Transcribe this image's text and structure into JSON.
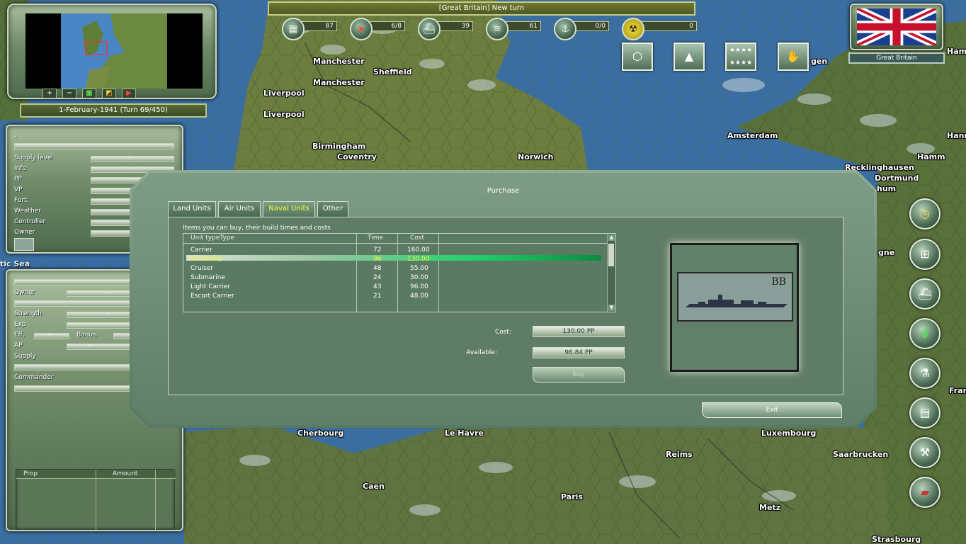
{
  "map": {
    "cities": [
      "Manchester",
      "Manchester",
      "Sheffield",
      "Liverpool",
      "Liverpool",
      "Birmingham",
      "Coventry",
      "Norwich",
      "Amsterdam",
      "Hamm",
      "Hamm",
      "Hann",
      "Recklinghausen",
      "Dortmund",
      "hum",
      "gen",
      "Cherbourg",
      "Le Havre",
      "Luxembourg",
      "Reims",
      "Saarbrucken",
      "Caen",
      "Paris",
      "Metz",
      "Strasbourg",
      "Fran",
      "gne"
    ],
    "sea_label": "tic Sea"
  },
  "top_bar": {
    "message": "[Great Britain] New turn"
  },
  "resources": [
    {
      "icon": "factory-icon",
      "glyph": "▦",
      "value": "87"
    },
    {
      "icon": "plane-icon",
      "glyph": "➤",
      "value": "6/8"
    },
    {
      "icon": "ship-icon",
      "glyph": "⛴",
      "value": "39"
    },
    {
      "icon": "transport-icon",
      "glyph": "≋",
      "value": "61"
    },
    {
      "icon": "submarine-icon",
      "glyph": "⚓",
      "value": "0/0"
    },
    {
      "icon": "nuclear-icon",
      "glyph": "☢",
      "value": "0"
    }
  ],
  "top_buttons": [
    {
      "name": "hex-grid-button",
      "glyph": "⬡"
    },
    {
      "name": "tank-button",
      "glyph": "▲"
    },
    {
      "name": "stars-button",
      "glyph": "★★★★"
    },
    {
      "name": "diplomacy-button",
      "glyph": "✋"
    }
  ],
  "nation": {
    "name": "Great Britain"
  },
  "minimap": {
    "buttons": [
      "+",
      "−",
      "▦",
      "◩",
      "▶"
    ]
  },
  "turn": {
    "text": "1-February-1941 (Turn 69/450)"
  },
  "hex_panel": {
    "top_value": "-",
    "fields": [
      {
        "label": "Supply level",
        "value": "-"
      },
      {
        "label": "Info",
        "value": "-"
      },
      {
        "label": "PP",
        "value": "-"
      },
      {
        "label": "VP",
        "value": "-"
      },
      {
        "label": "Fort.",
        "value": "-"
      },
      {
        "label": "Weather",
        "value": "-"
      },
      {
        "label": "Controller",
        "value": "-"
      },
      {
        "label": "Owner",
        "value": "-"
      }
    ]
  },
  "unit_panel": {
    "fields": [
      {
        "label": "Owner",
        "value": "-"
      },
      {
        "label": "Strength",
        "value": "-"
      },
      {
        "label": "Exp",
        "value": "-"
      },
      {
        "label": "Eff.",
        "value": "-"
      },
      {
        "label": "AP",
        "value": "-"
      },
      {
        "label": "Supply",
        "value": ""
      },
      {
        "label": "Commander",
        "value": ""
      }
    ],
    "bonus_label": "Bonus",
    "table_headers": [
      "Prop",
      "Amount"
    ]
  },
  "right_buttons": [
    {
      "name": "clock-button",
      "glyph": "◷"
    },
    {
      "name": "network-button",
      "glyph": "⊞"
    },
    {
      "name": "fleet-button",
      "glyph": "⛴"
    },
    {
      "name": "money-button",
      "glyph": "$"
    },
    {
      "name": "research-button",
      "glyph": "⚗"
    },
    {
      "name": "computer-button",
      "glyph": "▤"
    },
    {
      "name": "tools-button",
      "glyph": "⚒"
    },
    {
      "name": "book-button",
      "glyph": "▰"
    }
  ],
  "purchase": {
    "title": "Purchase",
    "tabs": [
      {
        "label": "Land Units",
        "active": false
      },
      {
        "label": "Air Units",
        "active": false
      },
      {
        "label": "Naval Units",
        "active": true
      },
      {
        "label": "Other",
        "active": false
      }
    ],
    "caption": "Items you can buy, their build times and costs",
    "columns": [
      "Unit typeType",
      "Time",
      "Cost"
    ],
    "rows": [
      {
        "type": "Carrier",
        "time": "72",
        "cost": "160.00",
        "selected": false
      },
      {
        "type": "Battleship",
        "time": "96",
        "cost": "130.00",
        "selected": true
      },
      {
        "type": "Cruiser",
        "time": "48",
        "cost": "55.00",
        "selected": false
      },
      {
        "type": "Submarine",
        "time": "24",
        "cost": "30.00",
        "selected": false
      },
      {
        "type": "Light Carrier",
        "time": "43",
        "cost": "96.00",
        "selected": false
      },
      {
        "type": "Escort Carrier",
        "time": "21",
        "cost": "48.00",
        "selected": false
      }
    ],
    "cost_label": "Cost:",
    "cost_value": "130.00 PP",
    "available_label": "Available:",
    "available_value": "96.84 PP",
    "buy_label": "Buy",
    "preview_code": "BB",
    "exit_label": "Exit"
  }
}
